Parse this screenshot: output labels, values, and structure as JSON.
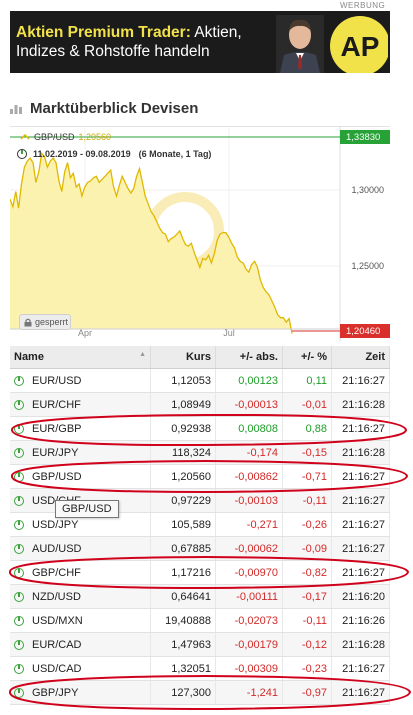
{
  "ad": {
    "label": "WERBUNG",
    "line1_highlight": "Aktien Premium Trader:",
    "line1_rest": " Aktien,",
    "line2": "Indizes & Rohstoffe handeln",
    "logo_text": "AP",
    "colors": {
      "background": "#1b1b1b",
      "highlight": "#f1e24a"
    }
  },
  "section": {
    "title": "Marktüberblick Devisen",
    "icon": "bar-chart-icon"
  },
  "chart": {
    "instrument_label": "GBP/USD",
    "instrument_value": "1,20560",
    "date_range": "11.02.2019 - 09.08.2019",
    "period_info": "(6 Monate, 1 Tag)",
    "locked_label": "gesperrt",
    "watermark": "CT",
    "top_tag": "1,33830",
    "bottom_tag": "1,20460",
    "colors": {
      "line": "#e0b800",
      "fill": "#fcf2b0",
      "top_tag": "#27a236",
      "bottom_tag": "#d9302c"
    }
  },
  "chart_data": {
    "type": "area",
    "x_tick_labels": [
      "Apr",
      "Jul"
    ],
    "y_tick_labels": [
      "1,30000",
      "1,25000"
    ],
    "ylim": [
      1.2,
      1.345
    ],
    "series": [
      {
        "name": "GBP/USD",
        "values": [
          1.294,
          1.289,
          1.299,
          1.288,
          1.304,
          1.315,
          1.319,
          1.321,
          1.318,
          1.305,
          1.312,
          1.324,
          1.322,
          1.315,
          1.319,
          1.321,
          1.318,
          1.306,
          1.299,
          1.312,
          1.318,
          1.308,
          1.311,
          1.302,
          1.304,
          1.296,
          1.302,
          1.305,
          1.306,
          1.308,
          1.309,
          1.305,
          1.307,
          1.309,
          1.311,
          1.313,
          1.302,
          1.296,
          1.303,
          1.309,
          1.305,
          1.301,
          1.298,
          1.301,
          1.309,
          1.314,
          1.305,
          1.296,
          1.291,
          1.286,
          1.283,
          1.279,
          1.275,
          1.272,
          1.271,
          1.266,
          1.268,
          1.269,
          1.271,
          1.273,
          1.268,
          1.264,
          1.263,
          1.265,
          1.259,
          1.254,
          1.249,
          1.255,
          1.254,
          1.257,
          1.252,
          1.258,
          1.267,
          1.271,
          1.272,
          1.272,
          1.269,
          1.265,
          1.262,
          1.256,
          1.253,
          1.252,
          1.248,
          1.246,
          1.251,
          1.253,
          1.249,
          1.241,
          1.236,
          1.233,
          1.231,
          1.227,
          1.223,
          1.218,
          1.216,
          1.216,
          1.213,
          1.2154,
          1.2056
        ]
      }
    ]
  },
  "table": {
    "headers": {
      "name": "Name",
      "kurs": "Kurs",
      "abs": "+/- abs.",
      "pct": "+/- %",
      "zeit": "Zeit"
    },
    "rows": [
      {
        "name": "EUR/USD",
        "kurs": "1,12053",
        "abs": "0,00123",
        "pct": "0,11",
        "zeit": "21:16:27",
        "dir": "pos"
      },
      {
        "name": "EUR/CHF",
        "kurs": "1,08949",
        "abs": "-0,00013",
        "pct": "-0,01",
        "zeit": "21:16:28",
        "dir": "neg"
      },
      {
        "name": "EUR/GBP",
        "kurs": "0,92938",
        "abs": "0,00808",
        "pct": "0,88",
        "zeit": "21:16:27",
        "dir": "pos"
      },
      {
        "name": "EUR/JPY",
        "kurs": "118,324",
        "abs": "-0,174",
        "pct": "-0,15",
        "zeit": "21:16:28",
        "dir": "neg"
      },
      {
        "name": "GBP/USD",
        "kurs": "1,20560",
        "abs": "-0,00862",
        "pct": "-0,71",
        "zeit": "21:16:27",
        "dir": "neg"
      },
      {
        "name": "USD/CHF",
        "kurs": "0,97229",
        "abs": "-0,00103",
        "pct": "-0,11",
        "zeit": "21:16:27",
        "dir": "neg"
      },
      {
        "name": "USD/JPY",
        "kurs": "105,589",
        "abs": "-0,271",
        "pct": "-0,26",
        "zeit": "21:16:27",
        "dir": "neg"
      },
      {
        "name": "AUD/USD",
        "kurs": "0,67885",
        "abs": "-0,00062",
        "pct": "-0,09",
        "zeit": "21:16:27",
        "dir": "neg"
      },
      {
        "name": "GBP/CHF",
        "kurs": "1,17216",
        "abs": "-0,00970",
        "pct": "-0,82",
        "zeit": "21:16:27",
        "dir": "neg"
      },
      {
        "name": "NZD/USD",
        "kurs": "0,64641",
        "abs": "-0,00111",
        "pct": "-0,17",
        "zeit": "21:16:20",
        "dir": "neg"
      },
      {
        "name": "USD/MXN",
        "kurs": "19,40888",
        "abs": "-0,02073",
        "pct": "-0,11",
        "zeit": "21:16:26",
        "dir": "neg"
      },
      {
        "name": "EUR/CAD",
        "kurs": "1,47963",
        "abs": "-0,00179",
        "pct": "-0,12",
        "zeit": "21:16:28",
        "dir": "neg"
      },
      {
        "name": "USD/CAD",
        "kurs": "1,32051",
        "abs": "-0,00309",
        "pct": "-0,23",
        "zeit": "21:16:27",
        "dir": "neg"
      },
      {
        "name": "GBP/JPY",
        "kurs": "127,300",
        "abs": "-1,241",
        "pct": "-0,97",
        "zeit": "21:16:27",
        "dir": "neg"
      }
    ]
  },
  "tooltip": {
    "text": "GBP/USD"
  },
  "annotations": {
    "highlighted_rows": [
      "EUR/GBP",
      "GBP/USD",
      "GBP/CHF",
      "GBP/JPY"
    ],
    "color": "#d0021b"
  }
}
